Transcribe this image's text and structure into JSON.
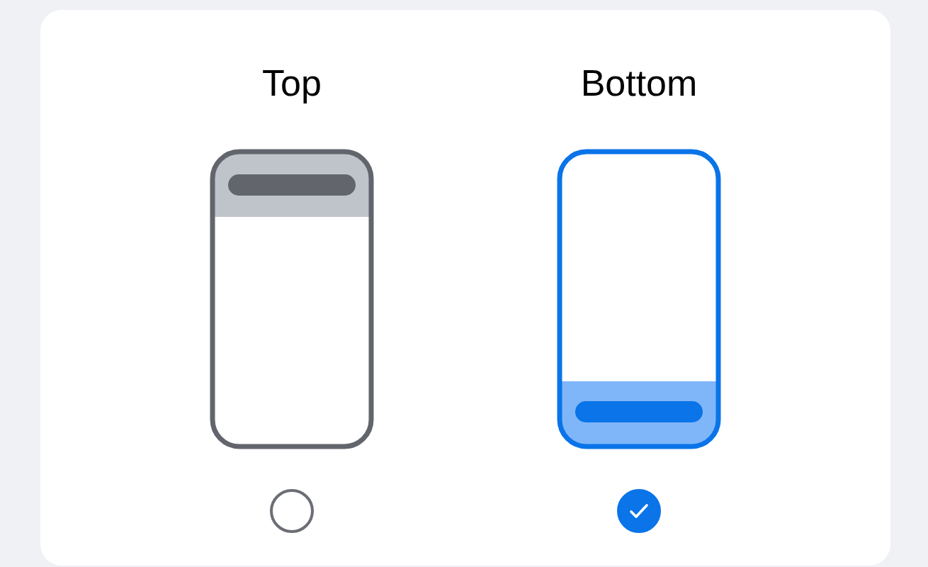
{
  "options": [
    {
      "label": "Top",
      "kind": "top",
      "selected": false
    },
    {
      "label": "Bottom",
      "kind": "bottom",
      "selected": true
    }
  ]
}
